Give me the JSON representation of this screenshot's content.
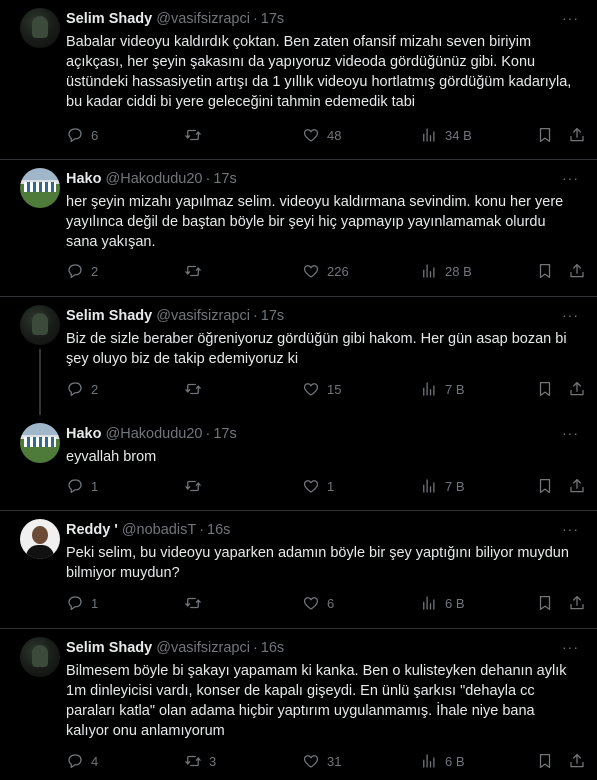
{
  "tweets": [
    {
      "avatar": "selim",
      "name": "Selim Shady",
      "handle": "@vasifsizrapci",
      "time": "17s",
      "text": "Babalar videoyu kaldırdık çoktan. Ben zaten ofansif mizahı seven biriyim açıkçası, her şeyin şakasını da yapıyoruz videoda gördüğünüz gibi. Konu üstündeki hassasiyetin artışı da 1 yıllık videoyu hortlatmış gördüğüm kadarıyla, bu kadar ciddi bi yere geleceğini tahmin edemedik tabi",
      "replies": "6",
      "retweets": "",
      "likes": "48",
      "views": "34 B"
    },
    {
      "avatar": "hako",
      "name": "Hako",
      "handle": "@Hakodudu20",
      "time": "17s",
      "text": "her şeyin mizahı yapılmaz selim. videoyu kaldırmana sevindim. konu her yere yayılınca değil de baştan böyle bir şeyi hiç yapmayıp yayınlamamak olurdu sana yakışan.",
      "replies": "2",
      "retweets": "",
      "likes": "226",
      "views": "28 B"
    },
    {
      "avatar": "selim",
      "name": "Selim Shady",
      "handle": "@vasifsizrapci",
      "time": "17s",
      "text": "Biz de sizle beraber öğreniyoruz gördüğün gibi hakom. Her gün asap bozan bi şey oluyo biz de takip edemiyoruz ki",
      "replies": "2",
      "retweets": "",
      "likes": "15",
      "views": "7 B"
    },
    {
      "avatar": "hako",
      "name": "Hako",
      "handle": "@Hakodudu20",
      "time": "17s",
      "text": "eyvallah brom",
      "replies": "1",
      "retweets": "",
      "likes": "1",
      "views": "7 B"
    },
    {
      "avatar": "reddy",
      "name": "Reddy '",
      "handle": "@nobadisT",
      "time": "16s",
      "text": "Peki selim, bu videoyu yaparken adamın böyle bir şey yaptığını biliyor muydun bilmiyor muydun?",
      "replies": "1",
      "retweets": "",
      "likes": "6",
      "views": "6 B"
    },
    {
      "avatar": "selim",
      "name": "Selim Shady",
      "handle": "@vasifsizrapci",
      "time": "16s",
      "text": "Bilmesem böyle bi şakayı yapamam ki kanka. Ben o kulisteyken dehanın aylık 1m dinleyicisi vardı, konser de kapalı gişeydi. En ünlü şarkısı \"dehayla cc paraları katla\" olan adama hiçbir yaptırım uygulanmamış. İhale niye bana kalıyor onu anlamıyorum",
      "replies": "4",
      "retweets": "3",
      "likes": "31",
      "views": "6 B"
    }
  ],
  "icons": {
    "reply": "reply-icon",
    "retweet": "retweet-icon",
    "like": "heart-icon",
    "views": "views-chart-icon",
    "bookmark": "bookmark-icon",
    "share": "share-icon",
    "more": "more-dots-icon"
  },
  "colors": {
    "background": "#000000",
    "text": "#e7e9ea",
    "secondary": "#71767b",
    "divider": "#2f3336"
  },
  "more_glyph": "···"
}
